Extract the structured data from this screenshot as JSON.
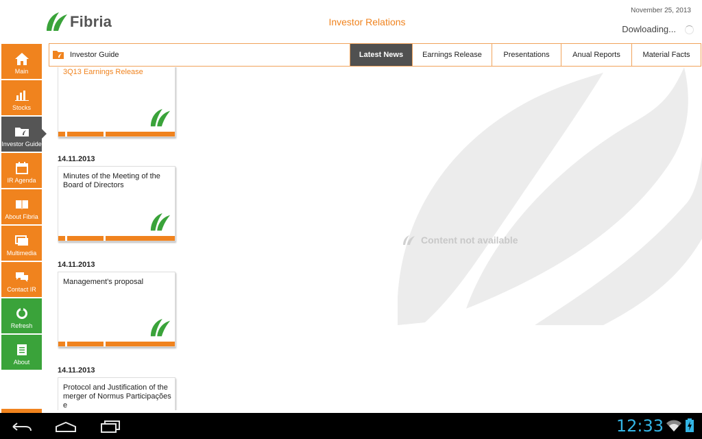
{
  "header": {
    "logo_text": "Fibria",
    "title": "Investor Relations",
    "date": "November 25, 2013",
    "status": "Dowloading..."
  },
  "sidebar": {
    "items": [
      {
        "label": "Main",
        "icon": "home-icon"
      },
      {
        "label": "Stocks",
        "icon": "bar-chart-icon"
      },
      {
        "label": "Investor Guide",
        "icon": "folder-icon"
      },
      {
        "label": "IR Agenda",
        "icon": "calendar-icon"
      },
      {
        "label": "About Fibria",
        "icon": "book-icon"
      },
      {
        "label": "Multimedia",
        "icon": "media-icon"
      },
      {
        "label": "Contact IR",
        "icon": "chat-icon"
      },
      {
        "label": "Refresh",
        "icon": "refresh-icon"
      },
      {
        "label": "About",
        "icon": "document-icon"
      }
    ],
    "active": "Investor Guide"
  },
  "tabbar": {
    "section": "Investor Guide",
    "tabs": [
      "Latest News",
      "Earnings Release",
      "Presentations",
      "Anual Reports",
      "Material Facts"
    ],
    "active": "Latest News"
  },
  "news": [
    {
      "date": "",
      "title": "3Q13 Earnings Release"
    },
    {
      "date": "14.11.2013",
      "title": "Minutes of the Meeting of the Board of Directors"
    },
    {
      "date": "14.11.2013",
      "title": "Management's proposal"
    },
    {
      "date": "14.11.2013",
      "title": "Protocol and Justification of the merger of Normus Participações e"
    }
  ],
  "content": {
    "empty_message": "Content not available"
  },
  "system_bar": {
    "time": "12:33"
  },
  "colors": {
    "brand_orange": "#f0831e",
    "brand_green": "#3aa33a",
    "active_gray": "#555555",
    "clock_blue": "#33b5e5"
  }
}
